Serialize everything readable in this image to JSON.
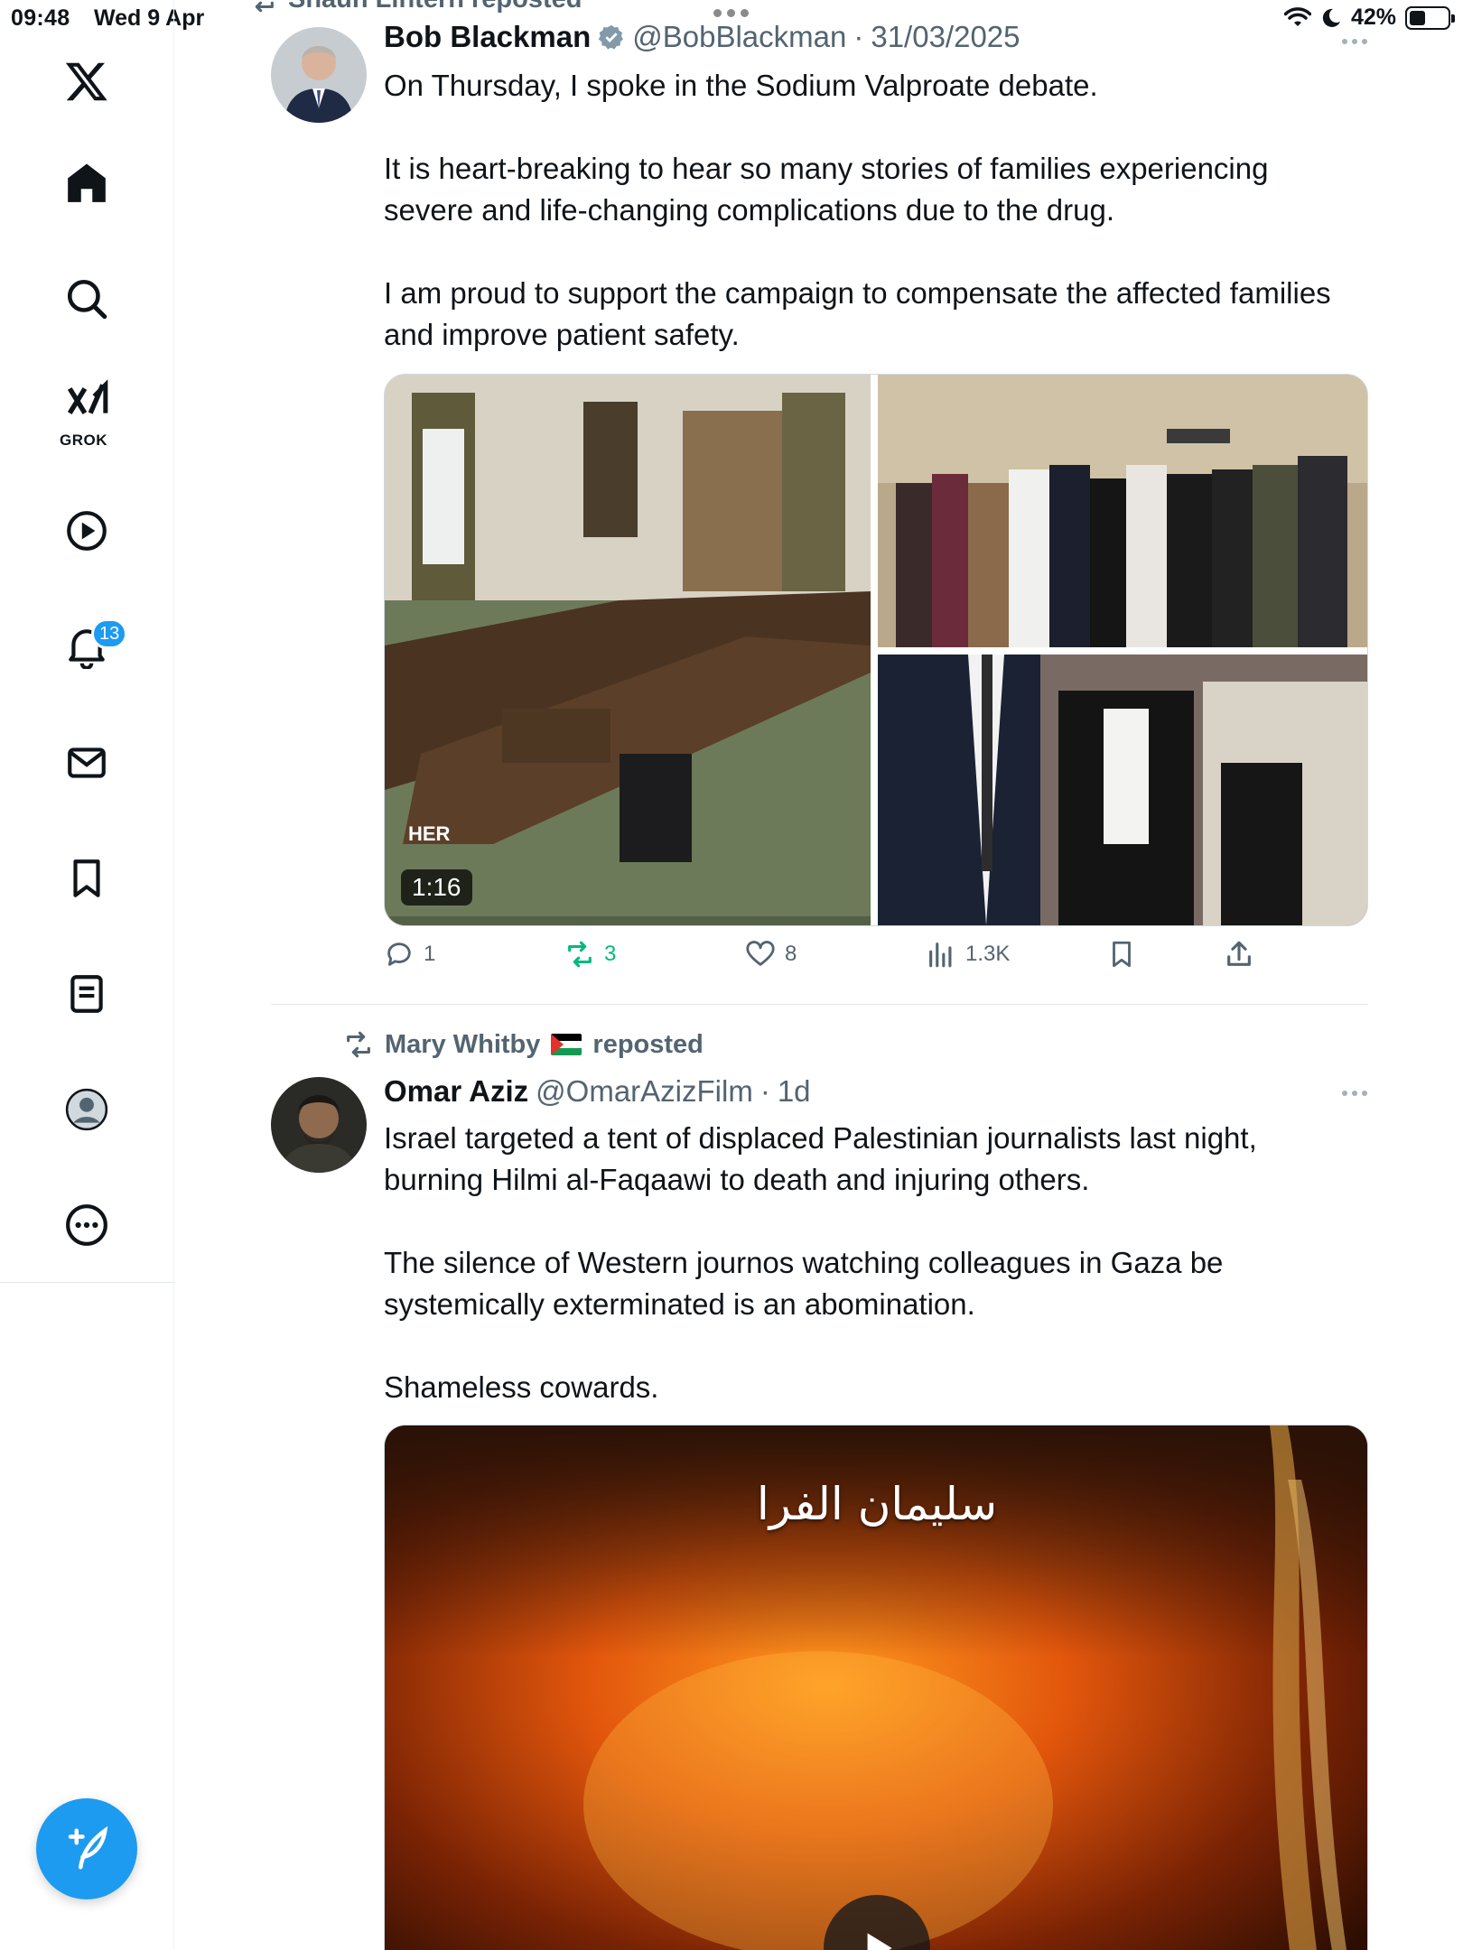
{
  "status_bar": {
    "time": "09:48",
    "date": "Wed 9 Apr",
    "battery": "42%",
    "battery_level": 0.42
  },
  "sidebar": {
    "items": [
      {
        "label": "X",
        "icon": "x-logo-icon"
      },
      {
        "label": "Home",
        "icon": "home-icon"
      },
      {
        "label": "Search",
        "icon": "search-icon"
      },
      {
        "label": "GROK",
        "icon": "grok-icon"
      },
      {
        "label": "Video",
        "icon": "video-icon"
      },
      {
        "label": "Notifications",
        "icon": "bell-icon"
      },
      {
        "label": "Messages",
        "icon": "mail-icon"
      },
      {
        "label": "Bookmarks",
        "icon": "bookmark-icon"
      },
      {
        "label": "Lists",
        "icon": "lists-icon"
      },
      {
        "label": "Profile",
        "icon": "profile-icon"
      },
      {
        "label": "More",
        "icon": "more-icon"
      }
    ],
    "grok_label": "GROK",
    "notification_count": "13"
  },
  "tweets": [
    {
      "reposted_by": "Shaun Lintern reposted",
      "name": "Bob Blackman",
      "handle": "@BobBlackman",
      "sep": "·",
      "time": "31/03/2025",
      "verified": true,
      "text": "On Thursday, I spoke in the Sodium Valproate debate.\n\nIt is heart-breaking to hear so many stories of families  experiencing severe and life-changing complications due to the drug.\n\nI am proud to support the campaign to compensate the affected families and improve patient safety.",
      "video_duration": "1:16",
      "video_caption": "HER",
      "stats": {
        "replies": "1",
        "reposts": "3",
        "likes": "8",
        "views": "1.3K"
      }
    },
    {
      "reposted_by": "Mary Whitby",
      "reposted_suffix": "reposted",
      "name": "Omar Aziz",
      "handle": "@OmarAzizFilm",
      "sep": "·",
      "time": "1d",
      "text": "Israel targeted a tent of displaced Palestinian journalists last night, burning Hilmi al-Faqaawi to death and injuring others.\n\nThe silence of Western journos watching colleagues in Gaza be systemically exterminated is an abomination.\n\nShameless cowards.",
      "video_overlay_text": "سليمان الفرا"
    }
  ],
  "colors": {
    "accent": "#1d9bf0",
    "repost_green": "#00ba7c",
    "muted": "#536471"
  }
}
